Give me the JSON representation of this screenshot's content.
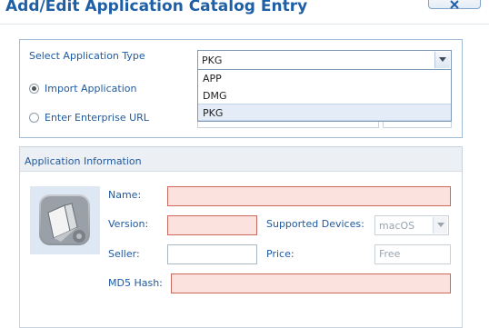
{
  "dialog": {
    "title": "Add/Edit Application Catalog Entry"
  },
  "app_type": {
    "label": "Select Application Type",
    "selected": "PKG",
    "options": [
      "APP",
      "DMG",
      "PKG"
    ],
    "import_label": "Import Application",
    "url_label": "Enter Enterprise URL"
  },
  "info": {
    "title": "Application Information",
    "name_label": "Name:",
    "version_label": "Version:",
    "seller_label": "Seller:",
    "md5_label": "MD5 Hash:",
    "devices_label": "Supported Devices:",
    "devices_value": "macOS",
    "price_label": "Price:",
    "price_placeholder": "Free"
  }
}
